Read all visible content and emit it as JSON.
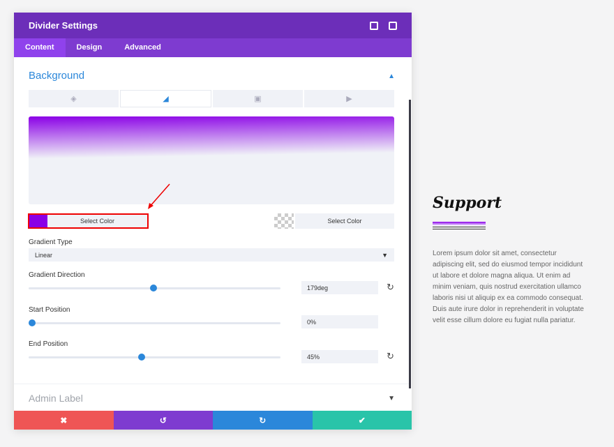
{
  "panel": {
    "title": "Divider Settings",
    "tabs": [
      "Content",
      "Design",
      "Advanced"
    ]
  },
  "background": {
    "title": "Background",
    "color1_label": "Select Color",
    "color2_label": "Select Color",
    "color1": "#8a00e6",
    "gradient_type_label": "Gradient Type",
    "gradient_type": "Linear",
    "direction_label": "Gradient Direction",
    "direction": "179deg",
    "direction_value": 179,
    "start_label": "Start Position",
    "start": "0%",
    "start_value": 0,
    "end_label": "End Position",
    "end": "45%",
    "end_value": 45
  },
  "admin_label": "Admin Label",
  "footer": {
    "colors": [
      "#ef5555",
      "#7e3bd0",
      "#2b87da",
      "#29c4a9"
    ]
  },
  "preview": {
    "title": "Support",
    "body": "Lorem ipsum dolor sit amet, consectetur adipiscing elit, sed do eiusmod tempor incididunt ut labore et dolore magna aliqua. Ut enim ad minim veniam, quis nostrud exercitation ullamco laboris nisi ut aliquip ex ea commodo consequat. Duis aute irure dolor in reprehenderit in voluptate velit esse cillum dolore eu fugiat nulla pariatur."
  }
}
